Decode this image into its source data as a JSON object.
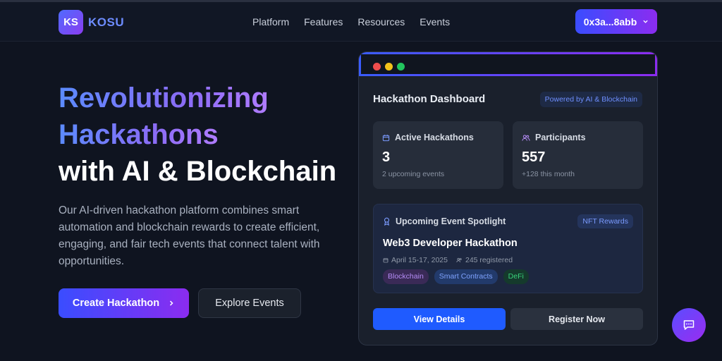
{
  "nav": {
    "logo_mark": "KS",
    "brand": "KOSU",
    "links": [
      "Platform",
      "Features",
      "Resources",
      "Events"
    ],
    "wallet": "0x3a...8abb",
    "wallet_icon": "chevron-down-icon"
  },
  "hero": {
    "line1": "Revolutionizing",
    "line2": "Hackathons",
    "line3": "with AI & Blockchain",
    "description": "Our AI-driven hackathon platform combines smart automation and blockchain rewards to create efficient, engaging, and fair tech events that connect talent with opportunities.",
    "primary_cta": "Create Hackathon",
    "primary_cta_icon": "chevron-right-icon",
    "secondary_cta": "Explore Events"
  },
  "dashboard": {
    "title": "Hackathon Dashboard",
    "badge": "Powered by AI & Blockchain",
    "stats": [
      {
        "icon": "calendar-icon",
        "label": "Active Hackathons",
        "value": "3",
        "sub": "2 upcoming events"
      },
      {
        "icon": "users-icon",
        "label": "Participants",
        "value": "557",
        "sub": "+128 this month"
      }
    ],
    "spotlight": {
      "icon": "award-icon",
      "heading": "Upcoming Event Spotlight",
      "badge": "NFT Rewards",
      "title": "Web3 Developer Hackathon",
      "date": "April 15-17, 2025",
      "registered": "245 registered",
      "tags": [
        "Blockchain",
        "Smart Contracts",
        "DeFi"
      ]
    },
    "view_button": "View Details",
    "register_button": "Register Now"
  },
  "chat": {
    "icon": "chat-icon"
  },
  "colors": {
    "background": "#0f1420",
    "accent_start": "#3a4dff",
    "accent_end": "#8b2cf0",
    "primary_blue": "#1f5bff"
  }
}
